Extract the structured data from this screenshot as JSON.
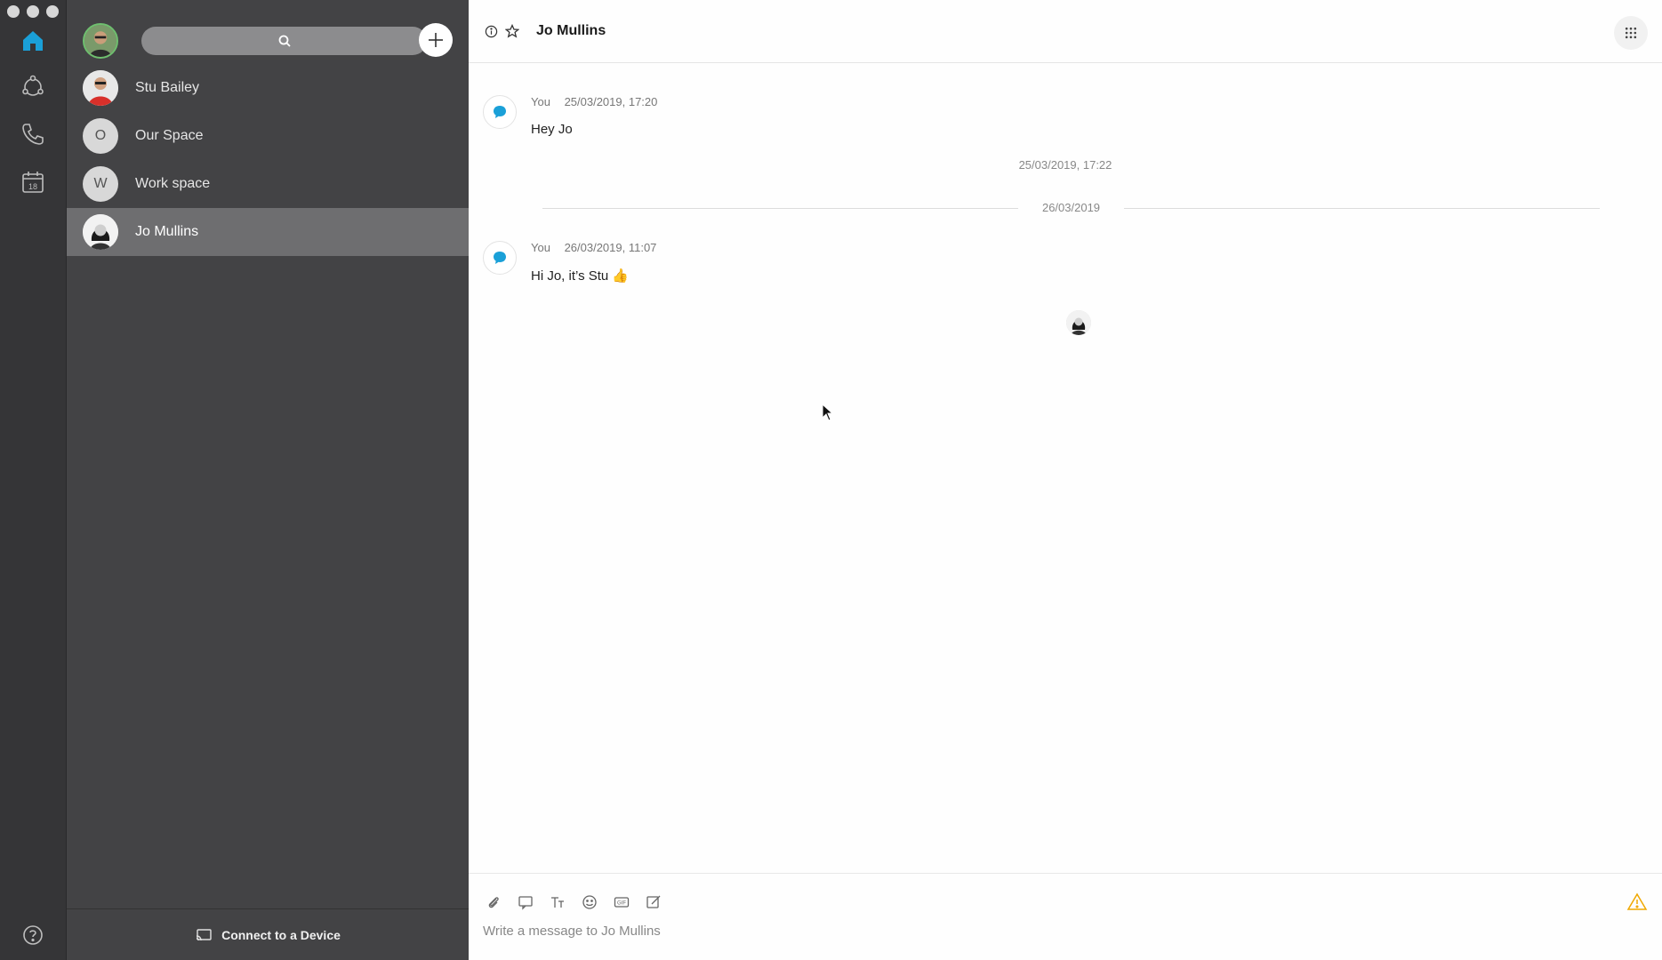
{
  "window": {
    "traffic_lights": [
      "close",
      "minimize",
      "zoom"
    ]
  },
  "rail": {
    "items": [
      {
        "icon": "home-icon",
        "active": true
      },
      {
        "icon": "teams-icon",
        "active": false
      },
      {
        "icon": "phone-icon",
        "active": false
      },
      {
        "icon": "calendar-icon",
        "active": false,
        "badge": "18"
      }
    ],
    "help_icon": "help-icon"
  },
  "panel": {
    "search_placeholder": "",
    "spaces": [
      {
        "label": "Stu Bailey",
        "type": "photo",
        "initial": ""
      },
      {
        "label": "Our Space",
        "type": "initial",
        "initial": "O"
      },
      {
        "label": "Work space",
        "type": "initial",
        "initial": "W"
      },
      {
        "label": "Jo Mullins",
        "type": "photo",
        "initial": "",
        "selected": true
      }
    ],
    "connect_label": "Connect to a Device"
  },
  "conversation": {
    "title": "Jo Mullins",
    "messages": [
      {
        "sender": "You",
        "time": "25/03/2019, 17:20",
        "text": "Hey Jo"
      },
      {
        "sender": "You",
        "time": "26/03/2019, 11:07",
        "text": "Hi Jo, it’s Stu 👍"
      }
    ],
    "standalone_time": "25/03/2019, 17:22",
    "date_divider": "26/03/2019",
    "composer_placeholder": "Write a message to Jo Mullins"
  },
  "colors": {
    "accent": "#1aa0d8",
    "rail_bg": "#353537",
    "panel_bg": "#434345",
    "selected_bg": "#6e6e70",
    "warning": "#f0a800"
  }
}
